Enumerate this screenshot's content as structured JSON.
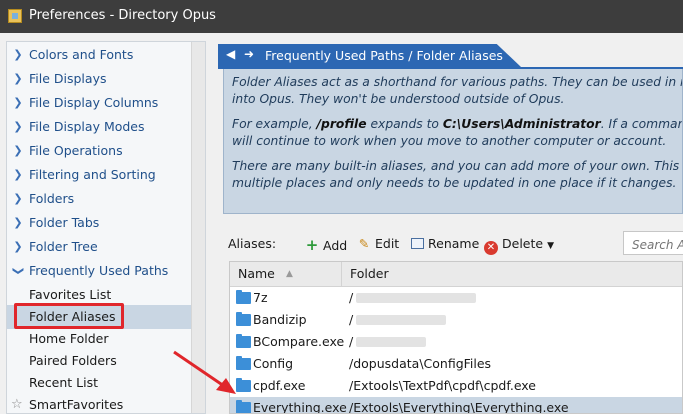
{
  "window": {
    "title": "Preferences - Directory Opus"
  },
  "tree": {
    "items": [
      {
        "label": "Colors and Fonts"
      },
      {
        "label": "File Displays"
      },
      {
        "label": "File Display Columns"
      },
      {
        "label": "File Display Modes"
      },
      {
        "label": "File Operations"
      },
      {
        "label": "Filtering and Sorting"
      },
      {
        "label": "Folders"
      },
      {
        "label": "Folder Tabs"
      },
      {
        "label": "Folder Tree"
      },
      {
        "label": "Frequently Used Paths"
      }
    ],
    "children": [
      {
        "label": "Favorites List"
      },
      {
        "label": "Folder Aliases"
      },
      {
        "label": "Home Folder"
      },
      {
        "label": "Paired Folders"
      },
      {
        "label": "Recent List"
      },
      {
        "label": "SmartFavorites"
      }
    ]
  },
  "page": {
    "title": "Frequently Used Paths / Folder Aliases",
    "info": {
      "p1_line1": "Folder Aliases act as a shorthand for various paths. They can be used in most",
      "p1_line2": "into Opus. They won't be understood outside of Opus.",
      "p2_pre": "For example, ",
      "p2_alias": "/profile",
      "p2_mid": " expands to ",
      "p2_path": "C:\\Users\\Administrator",
      "p2_post": ". If a command use",
      "p2_line2": "will continue to work when you move to another computer or account.",
      "p3_line1": "There are many built-in aliases, and you can add more of your own. This lets y",
      "p3_line2": "multiple places and only needs to be updated in one place if it changes."
    }
  },
  "toolbar": {
    "aliases_label": "Aliases:",
    "add": "Add",
    "edit": "Edit",
    "rename": "Rename",
    "delete": "Delete",
    "search_placeholder": "Search A"
  },
  "table": {
    "columns": [
      "Name",
      "Folder"
    ],
    "rows": [
      {
        "name": "7z",
        "folder": "/"
      },
      {
        "name": "Bandizip",
        "folder": "/"
      },
      {
        "name": "BCompare.exe",
        "folder": "/"
      },
      {
        "name": "Config",
        "folder": "/dopusdata\\ConfigFiles"
      },
      {
        "name": "cpdf.exe",
        "folder": "/Extools\\TextPdf\\cpdf\\cpdf.exe"
      },
      {
        "name": "Everything.exe",
        "folder": "/Extools\\Everything\\Everything.exe"
      }
    ]
  },
  "colors": {
    "accent": "#2c67b3",
    "info_bg": "#c9d6e3",
    "highlight_box": "#e0262b",
    "folder_icon": "#3c8fd8"
  }
}
